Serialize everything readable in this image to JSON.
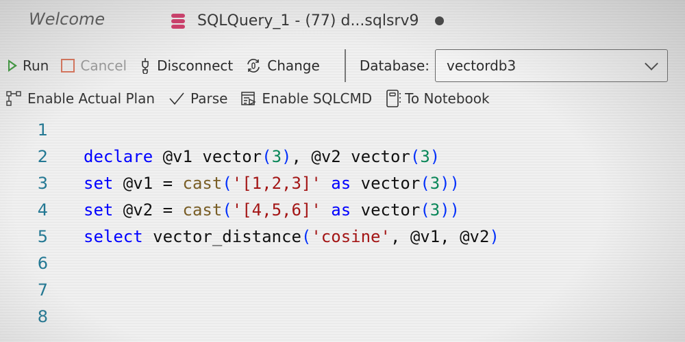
{
  "tabs": {
    "welcome": "Welcome",
    "active": "SQLQuery_1 - (77) d...sqlsrv9",
    "active_icon": "database-icon",
    "unsaved_indicator": "dot"
  },
  "toolbar": {
    "run": "Run",
    "cancel": "Cancel",
    "disconnect": "Disconnect",
    "change": "Change",
    "database_label": "Database:",
    "database_value": "vectordb3",
    "enable_actual_plan": "Enable Actual Plan",
    "parse": "Parse",
    "enable_sqlcmd": "Enable SQLCMD",
    "to_notebook": "To Notebook"
  },
  "colors": {
    "keyword": "#0000ff",
    "function": "#795e26",
    "string": "#a31515",
    "number": "#098658",
    "line_number": "#237893",
    "run_icon": "#3a9a3a",
    "cancel_icon": "#d9735a",
    "db_icon": "#d23b6a"
  },
  "editor": {
    "lines": [
      {
        "n": "1",
        "tokens": []
      },
      {
        "n": "2",
        "tokens": [
          [
            "kw",
            "declare"
          ],
          [
            "t",
            " @v1 vector"
          ],
          [
            "p",
            "("
          ],
          [
            "num",
            "3"
          ],
          [
            "p",
            ")"
          ],
          [
            "t",
            ", @v2 vector"
          ],
          [
            "p",
            "("
          ],
          [
            "num",
            "3"
          ],
          [
            "p",
            ")"
          ]
        ]
      },
      {
        "n": "3",
        "tokens": [
          [
            "kw",
            "set"
          ],
          [
            "t",
            " @v1 = "
          ],
          [
            "fn",
            "cast"
          ],
          [
            "p",
            "("
          ],
          [
            "str",
            "'[1,2,3]'"
          ],
          [
            "t",
            " "
          ],
          [
            "kw",
            "as"
          ],
          [
            "t",
            " vector"
          ],
          [
            "p",
            "("
          ],
          [
            "num",
            "3"
          ],
          [
            "p",
            "))"
          ]
        ]
      },
      {
        "n": "4",
        "tokens": [
          [
            "kw",
            "set"
          ],
          [
            "t",
            " @v2 = "
          ],
          [
            "fn",
            "cast"
          ],
          [
            "p",
            "("
          ],
          [
            "str",
            "'[4,5,6]'"
          ],
          [
            "t",
            " "
          ],
          [
            "kw",
            "as"
          ],
          [
            "t",
            " vector"
          ],
          [
            "p",
            "("
          ],
          [
            "num",
            "3"
          ],
          [
            "p",
            "))"
          ]
        ]
      },
      {
        "n": "5",
        "tokens": [
          [
            "kw",
            "select"
          ],
          [
            "t",
            " vector_distance"
          ],
          [
            "p",
            "("
          ],
          [
            "str",
            "'cosine'"
          ],
          [
            "t",
            ", @v1, @v2"
          ],
          [
            "p",
            ")"
          ]
        ]
      },
      {
        "n": "6",
        "tokens": []
      },
      {
        "n": "7",
        "tokens": []
      },
      {
        "n": "8",
        "tokens": []
      }
    ]
  }
}
